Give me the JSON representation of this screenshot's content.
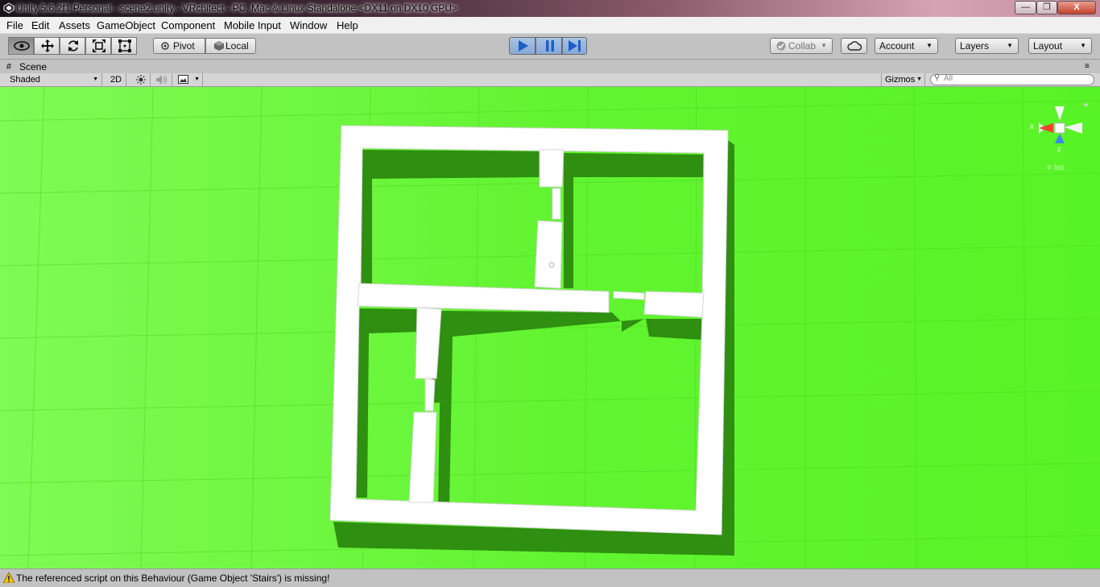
{
  "window": {
    "title": "Unity 5.6.2f1 Personal - scene2.unity - VRchitect - PC, Mac & Linux Standalone <DX11 on DX10 GPU>",
    "min_glyph": "—",
    "max_glyph": "❐",
    "close_glyph": "X"
  },
  "menu": {
    "items": [
      "File",
      "Edit",
      "Assets",
      "GameObject",
      "Component",
      "Mobile Input",
      "Window",
      "Help"
    ]
  },
  "toolbar": {
    "pivot_label": "Pivot",
    "local_label": "Local",
    "collab_label": "Collab",
    "account_label": "Account",
    "layers_label": "Layers",
    "layout_label": "Layout"
  },
  "scene_tab": {
    "label": "Scene",
    "shading_mode": "Shaded",
    "mode_2d": "2D",
    "gizmos_label": "Gizmos",
    "search_placeholder": "All"
  },
  "gizmo": {
    "x_label": "x",
    "z_label": "z",
    "view_label": "Iso",
    "colors": {
      "x": "#e8452e",
      "y": "#ffffff",
      "z": "#3e86ea"
    }
  },
  "status": {
    "message": "The referenced script on this Behaviour (Game Object 'Stairs') is missing!"
  },
  "colors": {
    "ground": "#5cf62e",
    "wall": "#ffffff",
    "shadow": "#2f8a10",
    "play_active": "#86a8d6"
  }
}
